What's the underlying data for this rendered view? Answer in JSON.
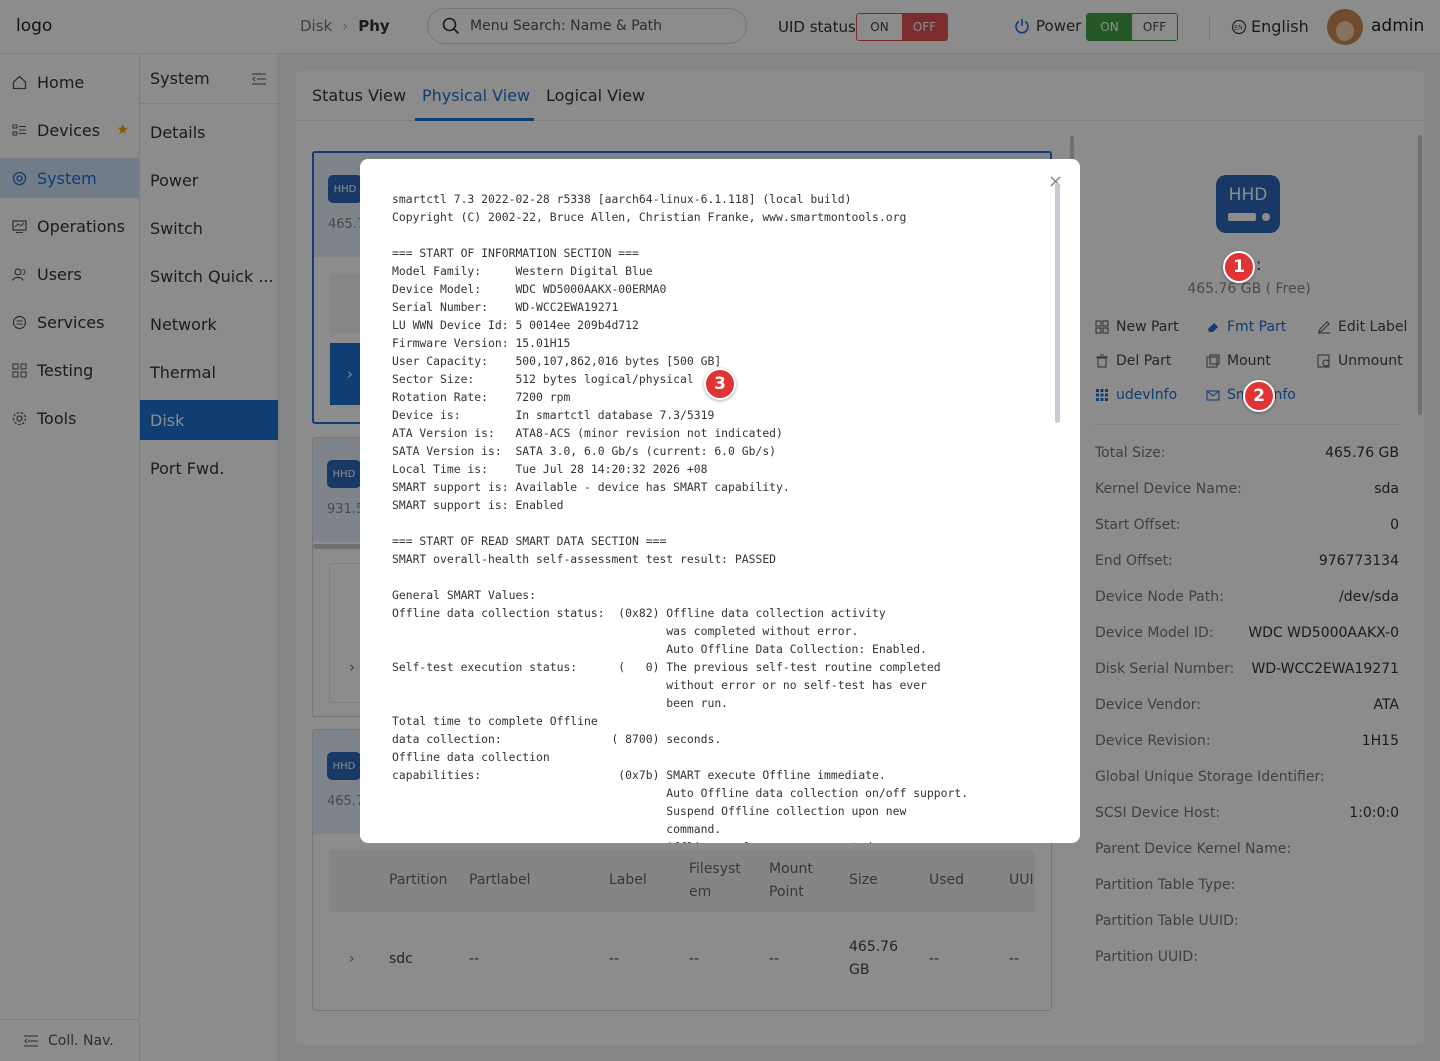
{
  "header": {
    "logo_alt": "logo",
    "breadcrumb": [
      "Disk",
      "Phy"
    ],
    "search_placeholder": "Menu Search: Name & Path",
    "uid_label": "UID status",
    "uid_on": "ON",
    "uid_off": "OFF",
    "power_label": "Power",
    "power_on": "ON",
    "power_off": "OFF",
    "language": "English",
    "user": "admin"
  },
  "nav": {
    "items": [
      {
        "label": "Home",
        "icon": "home-icon"
      },
      {
        "label": "Devices",
        "icon": "devices-icon",
        "starred": true
      },
      {
        "label": "System",
        "icon": "system-icon",
        "active": true
      },
      {
        "label": "Operations",
        "icon": "operations-icon"
      },
      {
        "label": "Users",
        "icon": "users-icon"
      },
      {
        "label": "Services",
        "icon": "services-icon"
      },
      {
        "label": "Testing",
        "icon": "testing-icon"
      },
      {
        "label": "Tools",
        "icon": "tools-icon"
      }
    ],
    "collapse_label": "Coll. Nav."
  },
  "subnav": {
    "title": "System",
    "items": [
      "Details",
      "Power",
      "Switch",
      "Switch Quick ...",
      "Network",
      "Thermal",
      "Disk",
      "Port Fwd."
    ],
    "active": "Disk"
  },
  "tabs": [
    "Status View",
    "Physical View",
    "Logical View"
  ],
  "active_tab": "Physical View",
  "disk_cards": [
    {
      "type": "HHD",
      "size": "465.7"
    },
    {
      "type": "HHD",
      "size": "931.5"
    },
    {
      "type": "HHD",
      "size": "465.7"
    }
  ],
  "partition_table": {
    "headers": [
      "Partition",
      "Partlabel",
      "Label",
      "Filesyst em",
      "Mount Point",
      "Size",
      "Used",
      "UUI"
    ],
    "rows": [
      {
        "partition": "sdc",
        "partlabel": "--",
        "label": "--",
        "filesystem": "--",
        "mount": "--",
        "size": "465.76 GB",
        "used": "--",
        "uuid": "--"
      }
    ]
  },
  "detail": {
    "disk_type": "HHD",
    "name_suffix": ":",
    "free": "465.76 GB ( Free)",
    "actions": [
      {
        "label": "New Part",
        "icon": "grid-icon"
      },
      {
        "label": "Fmt Part",
        "icon": "eraser-icon"
      },
      {
        "label": "Edit Label",
        "icon": "edit-icon"
      },
      {
        "label": "Del Part",
        "icon": "trash-icon"
      },
      {
        "label": "Mount",
        "icon": "mount-icon"
      },
      {
        "label": "Unmount",
        "icon": "unmount-icon"
      },
      {
        "label": "udevInfo",
        "icon": "dots-grid-icon"
      },
      {
        "label": "SmartInfo",
        "icon": "mail-icon"
      }
    ],
    "properties": [
      {
        "key": "Total Size:",
        "value": "465.76 GB"
      },
      {
        "key": "Kernel Device Name:",
        "value": "sda"
      },
      {
        "key": "Start Offset:",
        "value": "0"
      },
      {
        "key": "End Offset:",
        "value": "976773134"
      },
      {
        "key": "Device Node Path:",
        "value": "/dev/sda"
      },
      {
        "key": "Device Model ID:",
        "value": "WDC WD5000AAKX-0"
      },
      {
        "key": "Disk Serial Number:",
        "value": "WD-WCC2EWA19271"
      },
      {
        "key": "Device Vendor:",
        "value": "ATA"
      },
      {
        "key": "Device Revision:",
        "value": "1H15"
      },
      {
        "key": "Global Unique Storage Identifier:",
        "value": ""
      },
      {
        "key": "SCSI Device Host:",
        "value": "1:0:0:0"
      },
      {
        "key": "Parent Device Kernel Name:",
        "value": ""
      },
      {
        "key": "Partition Table Type:",
        "value": ""
      },
      {
        "key": "Partition Table UUID:",
        "value": ""
      },
      {
        "key": "Partition UUID:",
        "value": ""
      }
    ]
  },
  "modal": {
    "close_glyph": "×",
    "lines": [
      "smartctl 7.3 2022-02-28 r5338 [aarch64-linux-6.1.118] (local build)",
      "Copyright (C) 2002-22, Bruce Allen, Christian Franke, www.smartmontools.org",
      "",
      "=== START OF INFORMATION SECTION ===",
      "Model Family:     Western Digital Blue",
      "Device Model:     WDC WD5000AAKX-00ERMA0",
      "Serial Number:    WD-WCC2EWA19271",
      "LU WWN Device Id: 5 0014ee 209b4d712",
      "Firmware Version: 15.01H15",
      "User Capacity:    500,107,862,016 bytes [500 GB]",
      "Sector Size:      512 bytes logical/physical",
      "Rotation Rate:    7200 rpm",
      "Device is:        In smartctl database 7.3/5319",
      "ATA Version is:   ATA8-ACS (minor revision not indicated)",
      "SATA Version is:  SATA 3.0, 6.0 Gb/s (current: 6.0 Gb/s)",
      "Local Time is:    Tue Jul 28 14:20:32 2026 +08",
      "SMART support is: Available - device has SMART capability.",
      "SMART support is: Enabled",
      "",
      "=== START OF READ SMART DATA SECTION ===",
      "SMART overall-health self-assessment test result: PASSED",
      "",
      "General SMART Values:",
      "Offline data collection status:  (0x82) Offline data collection activity",
      "                                        was completed without error.",
      "                                        Auto Offline Data Collection: Enabled.",
      "Self-test execution status:      (   0) The previous self-test routine completed",
      "                                        without error or no self-test has ever",
      "                                        been run.",
      "Total time to complete Offline",
      "data collection:                ( 8700) seconds.",
      "Offline data collection",
      "capabilities:                    (0x7b) SMART execute Offline immediate.",
      "                                        Auto Offline data collection on/off support.",
      "                                        Suspend Offline collection upon new",
      "                                        command.",
      "                                        Offline surface scan supported."
    ]
  },
  "badges": [
    "1",
    "2",
    "3"
  ]
}
